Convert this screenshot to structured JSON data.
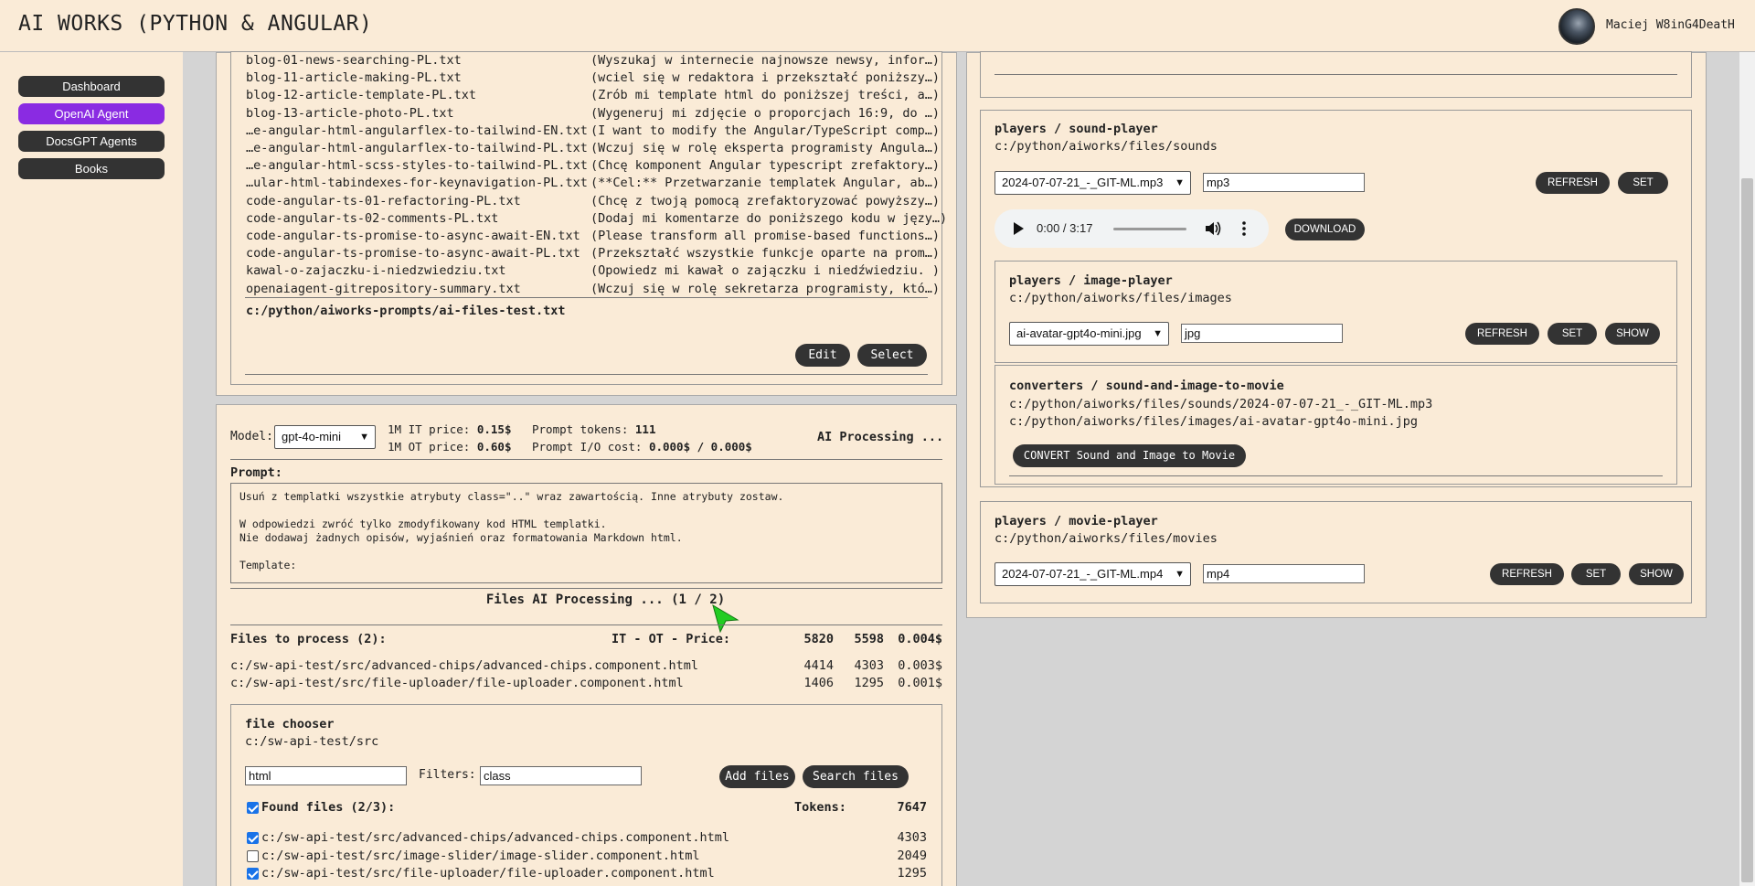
{
  "app": {
    "title": "AI WORKS (PYTHON & ANGULAR)",
    "user": "Maciej W8inG4DeatH"
  },
  "sidebar": {
    "items": [
      {
        "label": "Dashboard"
      },
      {
        "label": "OpenAI Agent"
      },
      {
        "label": "DocsGPT Agents"
      },
      {
        "label": "Books"
      }
    ]
  },
  "prompts": {
    "files": [
      {
        "name": "blog-01-news-searching-PL.txt",
        "preview": "(Wyszukaj w internecie najnowsze newsy, infor…)"
      },
      {
        "name": "blog-11-article-making-PL.txt",
        "preview": "(wciel się w redaktora i przekształć poniższy…)"
      },
      {
        "name": "blog-12-article-template-PL.txt",
        "preview": "(Zrób mi template html do poniższej treści, a…)"
      },
      {
        "name": "blog-13-article-photo-PL.txt",
        "preview": "(Wygeneruj mi zdjęcie o proporcjach 16:9, do …)"
      },
      {
        "name": "…e-angular-html-angularflex-to-tailwind-EN.txt",
        "preview": "(I want to modify the Angular/TypeScript comp…)"
      },
      {
        "name": "…e-angular-html-angularflex-to-tailwind-PL.txt",
        "preview": "(Wczuj się w rolę eksperta programisty Angula…)"
      },
      {
        "name": "…e-angular-html-scss-styles-to-tailwind-PL.txt",
        "preview": "(Chcę komponent Angular typescript zrefaktory…)"
      },
      {
        "name": "…ular-html-tabindexes-for-keynavigation-PL.txt",
        "preview": "(**Cel:** Przetwarzanie templatek Angular, ab…)"
      },
      {
        "name": "code-angular-ts-01-refactoring-PL.txt",
        "preview": "(Chcę z twoją pomocą zrefaktoryzować powyższy…)"
      },
      {
        "name": "code-angular-ts-02-comments-PL.txt",
        "preview": "(Dodaj mi komentarze do poniższego kodu w języ…)"
      },
      {
        "name": "code-angular-ts-promise-to-async-await-EN.txt",
        "preview": "(Please transform all promise-based functions…)"
      },
      {
        "name": "code-angular-ts-promise-to-async-await-PL.txt",
        "preview": "(Przekształć wszystkie funkcje oparte na prom…)"
      },
      {
        "name": "kawal-o-zajaczku-i-niedzwiedziu.txt",
        "preview": "(Opowiedz mi kawał o zajączku i niedźwiedziu. )"
      },
      {
        "name": "openaiagent-gitrepository-summary.txt",
        "preview": "(Wczuj się w rolę sekretarza programisty, któ…)"
      }
    ],
    "selected_path": "c:/python/aiworks-prompts/ai-files-test.txt",
    "edit_label": "Edit",
    "select_label": "Select"
  },
  "ai": {
    "model_label": "Model:",
    "model_value": "gpt-4o-mini",
    "it_price_label": "1M IT price:",
    "it_price": "0.15$",
    "ot_price_label": "1M OT price:",
    "ot_price": "0.60$",
    "prompt_tokens_label": "Prompt tokens:",
    "prompt_tokens": "111",
    "io_cost_label": "Prompt I/O cost:",
    "io_cost": "0.000$ / 0.000$",
    "status": "AI Processing ...",
    "prompt_label": "Prompt:",
    "prompt_lines": [
      "Usuń z templatki wszystkie atrybuty class=\"..\" wraz zawartością. Inne atrybuty zostaw.",
      "",
      "W odpowiedzi zwróć tylko zmodyfikowany kod HTML templatki.",
      "Nie dodawaj żadnych opisów, wyjaśnień oraz formatowania Markdown html.",
      "",
      "Template:"
    ],
    "files_processing": "Files AI Processing ... (1 / 2)"
  },
  "process": {
    "title": "Files to process (2):",
    "cols": "IT - OT - Price:",
    "total_it": "5820",
    "total_ot": "5598",
    "total_price": "0.004$",
    "rows": [
      {
        "path": "c:/sw-api-test/src/advanced-chips/advanced-chips.component.html",
        "it": "4414",
        "ot": "4303",
        "price": "0.003$"
      },
      {
        "path": "c:/sw-api-test/src/file-uploader/file-uploader.component.html",
        "it": "1406",
        "ot": "1295",
        "price": "0.001$"
      }
    ]
  },
  "chooser": {
    "title": "file chooser",
    "path": "c:/sw-api-test/src",
    "ext_value": "html",
    "filters_label": "Filters:",
    "filters_value": "class",
    "add_label": "Add files",
    "search_label": "Search files",
    "found_label": "Found files (2/3):",
    "tokens_label": "Tokens:",
    "tokens_value": "7647",
    "files": [
      {
        "path": "c:/sw-api-test/src/advanced-chips/advanced-chips.component.html",
        "tokens": "4303",
        "checked": true
      },
      {
        "path": "c:/sw-api-test/src/image-slider/image-slider.component.html",
        "tokens": "2049",
        "checked": false
      },
      {
        "path": "c:/sw-api-test/src/file-uploader/file-uploader.component.html",
        "tokens": "1295",
        "checked": true
      }
    ]
  },
  "sound": {
    "title": "players / sound-player",
    "path": "c:/python/aiworks/files/sounds",
    "select_value": "2024-07-07-21_-_GIT-ML.mp3",
    "filter_value": "mp3",
    "refresh_label": "REFRESH",
    "set_label": "SET",
    "time": "0:00 / 3:17",
    "download_label": "DOWNLOAD"
  },
  "image": {
    "title": "players / image-player",
    "path": "c:/python/aiworks/files/images",
    "select_value": "ai-avatar-gpt4o-mini.jpg",
    "filter_value": "jpg",
    "refresh_label": "REFRESH",
    "set_label": "SET",
    "show_label": "SHOW"
  },
  "converter": {
    "title": "converters / sound-and-image-to-movie",
    "sound_path": "c:/python/aiworks/files/sounds/2024-07-07-21_-_GIT-ML.mp3",
    "image_path": "c:/python/aiworks/files/images/ai-avatar-gpt4o-mini.jpg",
    "button_label": "CONVERT Sound and Image to Movie"
  },
  "movie": {
    "title": "players / movie-player",
    "path": "c:/python/aiworks/files/movies",
    "select_value": "2024-07-07-21_-_GIT-ML.mp4",
    "filter_value": "mp4",
    "refresh_label": "REFRESH",
    "set_label": "SET",
    "show_label": "SHOW"
  },
  "colors": {
    "background": "#faebd7",
    "active_nav": "#8a2be2",
    "button": "#333333",
    "cursor": "#22cc22"
  }
}
